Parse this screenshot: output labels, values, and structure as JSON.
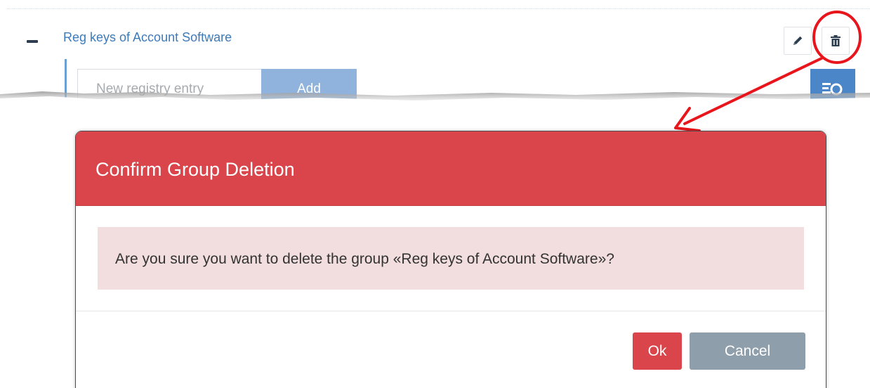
{
  "group": {
    "title": "Reg keys of Account Software",
    "registry_placeholder": "New registry entry",
    "add_label": "Add"
  },
  "dialog": {
    "title": "Confirm Group Deletion",
    "message": "Are you sure you want to delete the group «Reg keys of Account Software»?",
    "ok_label": "Ok",
    "cancel_label": "Cancel"
  },
  "icons": {
    "collapse": "minus-icon",
    "edit": "pencil-icon",
    "delete": "trash-icon",
    "filter": "filter-list-icon"
  },
  "colors": {
    "header_red": "#d9454b",
    "alert_bg": "#f2dede",
    "cancel_gray": "#8e9eab",
    "link_blue": "#3d7ab8",
    "annotation_red": "#e8161c"
  }
}
